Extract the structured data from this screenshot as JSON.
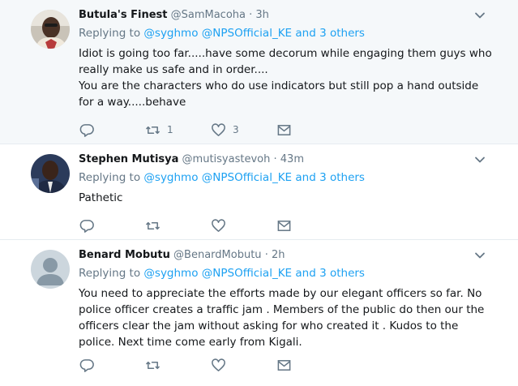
{
  "tweets": [
    {
      "name": "Butula's Finest",
      "handle": "@SamMacoha",
      "dot": "·",
      "time": "3h",
      "replying_to_label": "Replying to",
      "mentions": [
        "@syghmo",
        "@NPSOfficial_KE"
      ],
      "others": "and 3 others",
      "lines": [
        "Idiot is going too far.....have some decorum while engaging them guys who really make us safe and in order....",
        "You are the characters who do use indicators but still pop a hand outside for a way.....behave"
      ],
      "retweets": "1",
      "likes": "3"
    },
    {
      "name": "Stephen Mutisya",
      "handle": "@mutisyastevoh",
      "dot": "·",
      "time": "43m",
      "replying_to_label": "Replying to",
      "mentions": [
        "@syghmo",
        "@NPSOfficial_KE"
      ],
      "others": "and 3 others",
      "lines": [
        "Pathetic"
      ],
      "retweets": "",
      "likes": ""
    },
    {
      "name": "Benard Mobutu",
      "handle": "@BenardMobutu",
      "dot": "·",
      "time": "2h",
      "replying_to_label": "Replying to",
      "mentions": [
        "@syghmo",
        "@NPSOfficial_KE"
      ],
      "others": "and 3 others",
      "lines": [
        "You need to appreciate the efforts made by our elegant officers so far. No police officer creates a traffic jam . Members of the public do then our the officers clear the jam without asking for who created it . Kudos to the police. Next time come early from Kigali."
      ],
      "retweets": "",
      "likes": ""
    }
  ],
  "colors": {
    "link": "#1da1f2",
    "muted": "#657786",
    "text": "#14171a",
    "highlight_bg": "#f5f8fa",
    "divider": "#e6ecf0"
  },
  "icons": [
    "reply-icon",
    "retweet-icon",
    "like-icon",
    "message-icon",
    "chevron-down-icon"
  ]
}
